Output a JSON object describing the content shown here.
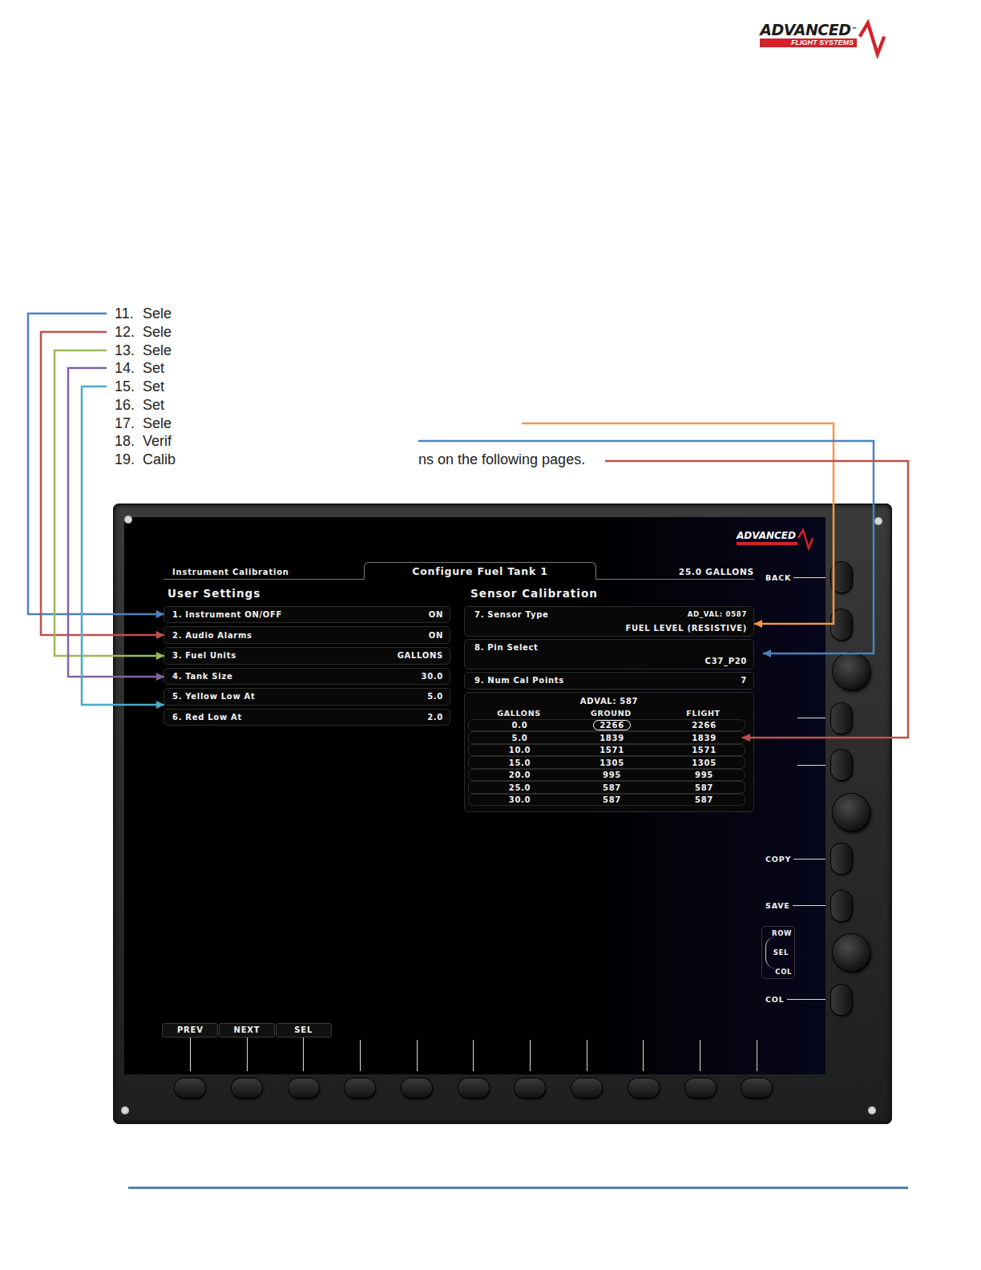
{
  "logo": {
    "name": "ADVANCED",
    "mark": "™",
    "sub": "FLIGHT SYSTEMS"
  },
  "steps": [
    {
      "number": "11.",
      "text": "Sele"
    },
    {
      "number": "12.",
      "text": "Sele"
    },
    {
      "number": "13.",
      "text": "Sele"
    },
    {
      "number": "14.",
      "text": "Set"
    },
    {
      "number": "15.",
      "text": "Set"
    },
    {
      "number": "16.",
      "text": "Set"
    },
    {
      "number": "17.",
      "text": "Sele"
    },
    {
      "number": "18.",
      "text": "Verif"
    },
    {
      "number": "19.",
      "text": "Calib",
      "tail": "ns on the following pages."
    }
  ],
  "device": {
    "screen_logo": "ADVANCED",
    "breadcrumb": "Instrument Calibration",
    "title": "Configure Fuel Tank 1",
    "reading": "25.0 GALLONS",
    "user_settings": {
      "title": "User Settings",
      "rows": [
        {
          "label": "1. Instrument ON/OFF",
          "value": "ON"
        },
        {
          "label": "2. Audio Alarms",
          "value": "ON"
        },
        {
          "label": "3. Fuel Units",
          "value": "GALLONS"
        },
        {
          "label": "4. Tank Size",
          "value": "30.0"
        },
        {
          "label": "5. Yellow Low At",
          "value": "5.0"
        },
        {
          "label": "6. Red Low At",
          "value": "2.0"
        }
      ]
    },
    "sensor": {
      "title": "Sensor Calibration",
      "sensor_type": {
        "label": "7. Sensor Type",
        "extra": "AD_VAL: 0587",
        "value": "FUEL LEVEL (RESISTIVE)"
      },
      "pin": {
        "label": "8. Pin Select",
        "value": "C37_P20"
      },
      "num_cal": {
        "label": "9. Num Cal Points",
        "value": "7"
      },
      "table": {
        "caption": "ADVAL: 587",
        "columns": [
          "GALLONS",
          "GROUND",
          "FLIGHT"
        ],
        "rows": [
          {
            "cells": [
              "0.0",
              "2266",
              "2266"
            ],
            "selected": true
          },
          {
            "cells": [
              "5.0",
              "1839",
              "1839"
            ],
            "selected": false
          },
          {
            "cells": [
              "10.0",
              "1571",
              "1571"
            ],
            "selected": false
          },
          {
            "cells": [
              "15.0",
              "1305",
              "1305"
            ],
            "selected": false
          },
          {
            "cells": [
              "20.0",
              "995",
              "995"
            ],
            "selected": false
          },
          {
            "cells": [
              "25.0",
              "587",
              "587"
            ],
            "selected": false
          },
          {
            "cells": [
              "30.0",
              "587",
              "587"
            ],
            "selected": false
          }
        ]
      }
    },
    "side_keys": [
      {
        "kind": "button",
        "label": "BACK",
        "marker": true
      },
      {
        "kind": "button",
        "marker": false
      },
      {
        "kind": "knob",
        "marker": false
      },
      {
        "kind": "button",
        "marker": true
      },
      {
        "kind": "button",
        "marker": true
      },
      {
        "kind": "knob",
        "marker": false
      },
      {
        "kind": "button",
        "label": "COPY",
        "marker": true
      },
      {
        "kind": "button",
        "label": "SAVE",
        "marker": true
      },
      {
        "kind": "knob",
        "marker": false,
        "knob_labels": [
          "ROW",
          "SEL",
          "COL"
        ]
      },
      {
        "kind": "button",
        "label": "COL",
        "marker": true
      }
    ],
    "bottom_keys": [
      {
        "label": "PREV"
      },
      {
        "label": "NEXT"
      },
      {
        "label": "SEL"
      },
      {},
      {},
      {},
      {},
      {},
      {},
      {},
      {}
    ]
  },
  "callouts": [
    {
      "color": "#4f81bd"
    },
    {
      "color": "#c0504d"
    },
    {
      "color": "#9bbb59"
    },
    {
      "color": "#8064a2"
    },
    {
      "color": "#4bacc6"
    },
    {
      "color": "#f79646"
    },
    {
      "color": "#4f81bd"
    },
    {
      "color": "#c0504d"
    }
  ]
}
